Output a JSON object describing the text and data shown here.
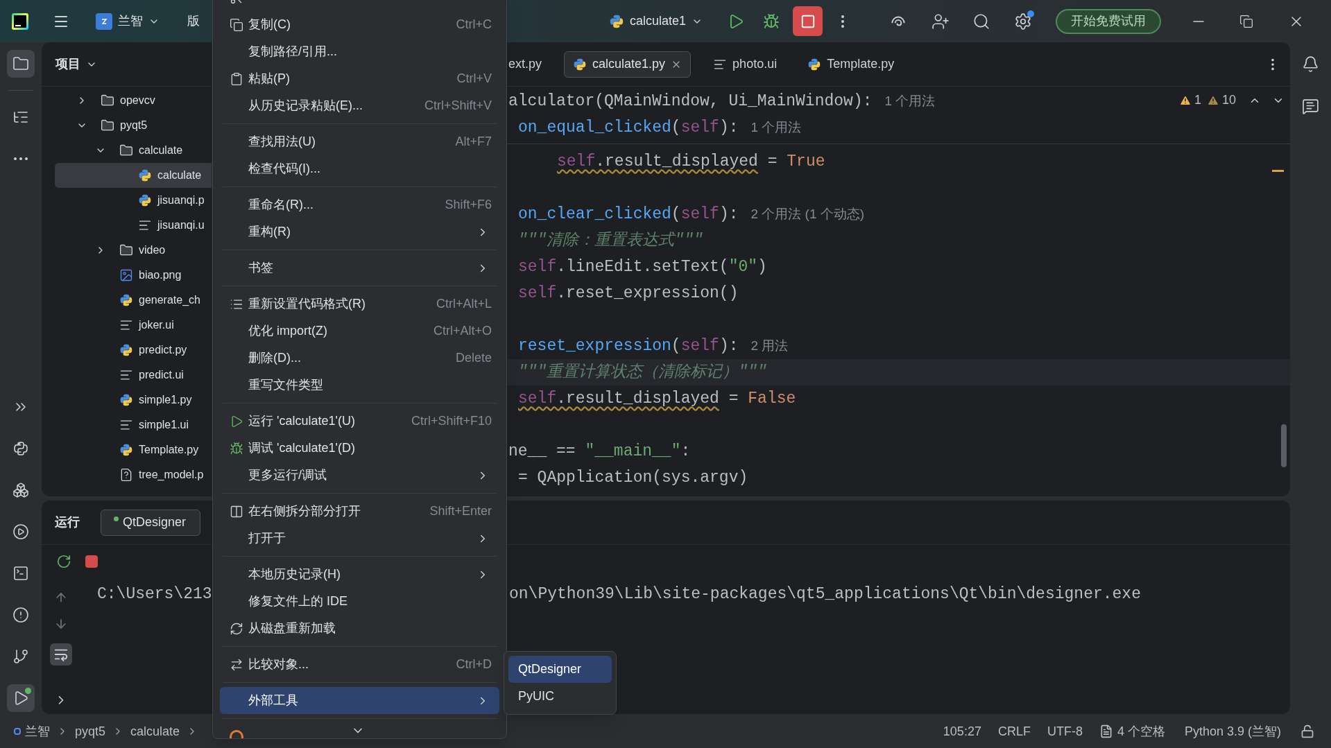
{
  "title_bar": {
    "project": "兰智",
    "vcs": "版",
    "run_config": "calculate1",
    "settings_badge": true,
    "trial_button": "开始免费试用"
  },
  "activity_bar": {
    "top": [
      {
        "kind": "folder",
        "selected": true,
        "running": false
      },
      {
        "kind": "structure",
        "selected": false,
        "running": false
      },
      {
        "kind": "more",
        "selected": false,
        "running": false
      }
    ],
    "bottom": [
      {
        "kind": "expand",
        "selected": false,
        "running": false
      },
      {
        "kind": "console",
        "selected": false,
        "running": false
      },
      {
        "kind": "packages",
        "selected": false,
        "running": false
      },
      {
        "kind": "services",
        "selected": false,
        "running": false
      },
      {
        "kind": "terminal",
        "selected": false,
        "running": false
      },
      {
        "kind": "problems",
        "selected": false,
        "running": false
      },
      {
        "kind": "git",
        "selected": false,
        "running": false
      },
      {
        "kind": "run",
        "selected": true,
        "running": true
      }
    ]
  },
  "project": {
    "title": "项目",
    "tree": [
      {
        "name": "opevcv",
        "kind": "folder",
        "expanded": false,
        "selected": false
      },
      {
        "name": "pyqt5",
        "kind": "folder",
        "expanded": true,
        "selected": false,
        "children": [
          {
            "name": "calculate",
            "kind": "folder",
            "expanded": true,
            "selected": false,
            "children": [
              {
                "name": "calculate",
                "kind": "python",
                "selected": true
              },
              {
                "name": "jisuanqi.p",
                "kind": "python",
                "selected": false
              },
              {
                "name": "jisuanqi.u",
                "kind": "ui",
                "selected": false
              }
            ]
          },
          {
            "name": "video",
            "kind": "folder",
            "expanded": false,
            "selected": false
          },
          {
            "name": "biao.png",
            "kind": "image",
            "selected": false
          },
          {
            "name": "generate_ch",
            "kind": "python",
            "selected": false
          },
          {
            "name": "joker.ui",
            "kind": "ui",
            "selected": false
          },
          {
            "name": "predict.py",
            "kind": "python",
            "selected": false
          },
          {
            "name": "predict.ui",
            "kind": "ui",
            "selected": false
          },
          {
            "name": "simple1.py",
            "kind": "python",
            "selected": false
          },
          {
            "name": "simple1.ui",
            "kind": "ui",
            "selected": false
          },
          {
            "name": "Template.py",
            "kind": "python",
            "selected": false
          },
          {
            "name": "tree_model.p",
            "kind": "unknown",
            "selected": false
          }
        ]
      }
    ]
  },
  "editor": {
    "tabs": [
      {
        "label": "ext.py",
        "selected": false
      },
      {
        "label": "calculate1.py",
        "kind": "python",
        "selected": true
      },
      {
        "label": "photo.ui",
        "kind": "ui",
        "selected": false
      },
      {
        "label": "Template.py",
        "kind": "python",
        "selected": false
      }
    ],
    "inspections": [
      {
        "kind": "warning",
        "count": "1"
      },
      {
        "kind": "weak",
        "count": "10"
      }
    ],
    "sticky_lines": [
      {
        "kind": "cut",
        "current": false,
        "segments": [
          {
            "kind": "plain",
            "text": "alculator(QMainWindow, Ui_MainWindow):"
          },
          {
            "kind": "hint",
            "text": "1 个用法"
          }
        ]
      },
      {
        "kind": "block",
        "current": false,
        "segments": [
          {
            "kind": "fn",
            "text": "on_equal_clicked"
          },
          {
            "kind": "plain",
            "text": "("
          },
          {
            "kind": "self",
            "text": "self"
          },
          {
            "kind": "plain",
            "text": "):"
          },
          {
            "kind": "hint",
            "text": "1 个用法"
          }
        ]
      }
    ],
    "lines": [
      {
        "kind": "nested",
        "current": false,
        "segments": [
          {
            "kind": "warned",
            "segments": [
              {
                "kind": "self",
                "text": "self"
              },
              {
                "kind": "plain",
                "text": ".result_displayed"
              }
            ]
          },
          {
            "kind": "plain",
            "text": " = "
          },
          {
            "kind": "keyword",
            "text": "True"
          }
        ]
      },
      {
        "kind": "block",
        "current": false
      },
      {
        "kind": "block",
        "current": false,
        "segments": [
          {
            "kind": "fn",
            "text": "on_clear_clicked"
          },
          {
            "kind": "plain",
            "text": "("
          },
          {
            "kind": "self",
            "text": "self"
          },
          {
            "kind": "plain",
            "text": "):"
          },
          {
            "kind": "hint",
            "text": "2 个用法 (1 个动态)"
          }
        ]
      },
      {
        "kind": "block",
        "current": false,
        "segments": [
          {
            "kind": "comment",
            "text": "\"\"\"清除：重置表达式\"\"\""
          }
        ]
      },
      {
        "kind": "block",
        "current": false,
        "segments": [
          {
            "kind": "self",
            "text": "self"
          },
          {
            "kind": "plain",
            "text": ".lineEdit.setText("
          },
          {
            "kind": "string",
            "text": "\"0\""
          },
          {
            "kind": "plain",
            "text": ")"
          }
        ]
      },
      {
        "kind": "block",
        "current": false,
        "segments": [
          {
            "kind": "self",
            "text": "self"
          },
          {
            "kind": "plain",
            "text": ".reset_expression()"
          }
        ]
      },
      {
        "kind": "block",
        "current": false
      },
      {
        "kind": "block",
        "current": false,
        "segments": [
          {
            "kind": "fn",
            "text": "reset_expression"
          },
          {
            "kind": "plain",
            "text": "("
          },
          {
            "kind": "self",
            "text": "self"
          },
          {
            "kind": "plain",
            "text": "):"
          },
          {
            "kind": "hint",
            "text": "2 用法"
          }
        ]
      },
      {
        "kind": "block",
        "current": true,
        "segments": [
          {
            "kind": "comment",
            "text": "\"\"\"重置计算状态（清除标记）\"\"\""
          }
        ]
      },
      {
        "kind": "block",
        "current": false,
        "segments": [
          {
            "kind": "warned",
            "segments": [
              {
                "kind": "self",
                "text": "self"
              },
              {
                "kind": "plain",
                "text": ".result_displayed"
              }
            ]
          },
          {
            "kind": "plain",
            "text": " = "
          },
          {
            "kind": "keyword",
            "text": "False"
          }
        ]
      },
      {
        "kind": "block",
        "current": false
      },
      {
        "kind": "cut",
        "current": false,
        "segments": [
          {
            "kind": "plain",
            "text": "ne__ == "
          },
          {
            "kind": "string",
            "text": "\"__main__\""
          },
          {
            "kind": "plain",
            "text": ":"
          }
        ]
      },
      {
        "kind": "block",
        "current": false,
        "segments": [
          {
            "kind": "plain",
            "text": "= QApplication(sys.argv)"
          }
        ]
      }
    ]
  },
  "run_panel": {
    "title": "运行",
    "tabs": [
      {
        "label": "QtDesigner",
        "selected": true,
        "running": true
      }
    ],
    "soft_wrap": true,
    "console": [
      "C:\\Users\\213",
      "on\\Python39\\Lib\\site-packages\\qt5_applications\\Qt\\bin\\designer.exe"
    ]
  },
  "context_menu": {
    "groups": [
      [
        {
          "kind": "scissors",
          "submenu": false,
          "selected": false
        },
        {
          "label": "复制(C)",
          "shortcut": "Ctrl+C",
          "kind": "copy",
          "submenu": false,
          "selected": false
        },
        {
          "label": "复制路径/引用...",
          "submenu": false,
          "selected": false
        },
        {
          "label": "粘贴(P)",
          "shortcut": "Ctrl+V",
          "kind": "paste",
          "submenu": false,
          "selected": false
        },
        {
          "label": "从历史记录粘贴(E)...",
          "shortcut": "Ctrl+Shift+V",
          "submenu": false,
          "selected": false
        }
      ],
      [
        {
          "label": "查找用法(U)",
          "shortcut": "Alt+F7",
          "submenu": false,
          "selected": false
        },
        {
          "label": "检查代码(I)...",
          "submenu": false,
          "selected": false
        }
      ],
      [
        {
          "label": "重命名(R)...",
          "shortcut": "Shift+F6",
          "submenu": false,
          "selected": false
        },
        {
          "label": "重构(R)",
          "submenu": true,
          "selected": false
        }
      ],
      [
        {
          "label": "书签",
          "submenu": true,
          "selected": false
        }
      ],
      [
        {
          "label": "重新设置代码格式(R)",
          "shortcut": "Ctrl+Alt+L",
          "kind": "format",
          "submenu": false,
          "selected": false
        },
        {
          "label": "优化 import(Z)",
          "shortcut": "Ctrl+Alt+O",
          "submenu": false,
          "selected": false
        },
        {
          "label": "删除(D)...",
          "shortcut": "Delete",
          "submenu": false,
          "selected": false
        },
        {
          "label": "重写文件类型",
          "submenu": false,
          "selected": false
        }
      ],
      [
        {
          "label": "运行 'calculate1'(U)",
          "shortcut": "Ctrl+Shift+F10",
          "kind": "run",
          "submenu": false,
          "selected": false
        },
        {
          "label": "调试 'calculate1'(D)",
          "kind": "debug",
          "submenu": false,
          "selected": false
        },
        {
          "label": "更多运行/调试",
          "submenu": true,
          "selected": false
        }
      ],
      [
        {
          "label": "在右侧拆分部分打开",
          "shortcut": "Shift+Enter",
          "kind": "split",
          "submenu": false,
          "selected": false
        },
        {
          "label": "打开于",
          "submenu": true,
          "selected": false
        }
      ],
      [
        {
          "label": "本地历史记录(H)",
          "submenu": true,
          "selected": false
        },
        {
          "label": "修复文件上的 IDE",
          "submenu": false,
          "selected": false
        },
        {
          "label": "从磁盘重新加载",
          "kind": "reload",
          "submenu": false,
          "selected": false
        }
      ],
      [
        {
          "label": "比较对象...",
          "shortcut": "Ctrl+D",
          "kind": "compare",
          "submenu": false,
          "selected": false
        }
      ],
      [
        {
          "label": "外部工具",
          "submenu": true,
          "selected": true
        }
      ],
      [
        {
          "kind": "jupyter",
          "submenu": false,
          "selected": false
        }
      ]
    ]
  },
  "submenu": {
    "items": [
      {
        "label": "QtDesigner",
        "selected": true
      },
      {
        "label": "PyUIC",
        "selected": false
      }
    ]
  },
  "status_bar": {
    "breadcrumbs": [
      "兰智",
      "pyqt5",
      "calculate"
    ],
    "position": "105:27",
    "line_ending": "CRLF",
    "encoding": "UTF-8",
    "indent": "4 个空格",
    "interpreter": "Python 3.9 (兰智)"
  }
}
